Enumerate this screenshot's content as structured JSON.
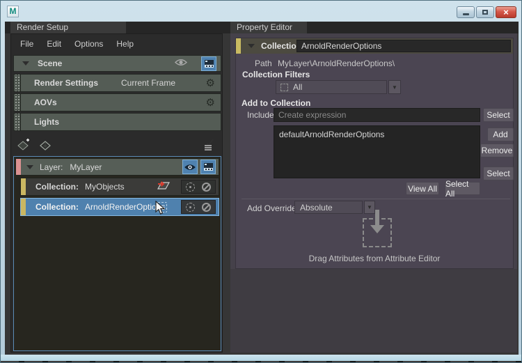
{
  "window": {
    "app_icon": "M",
    "controls": {
      "close_glyph": "×"
    }
  },
  "icons": {
    "gear": "⚙",
    "dropdown_arrow": "▼"
  },
  "tabs": {
    "left": "Render Setup",
    "right": "Property Editor"
  },
  "menu": {
    "items": [
      "File",
      "Edit",
      "Options",
      "Help"
    ]
  },
  "scene_panel": {
    "scene_label": "Scene",
    "rows": [
      {
        "label": "Render Settings",
        "value": "Current Frame"
      },
      {
        "label": "AOVs",
        "value": ""
      },
      {
        "label": "Lights",
        "value": ""
      }
    ]
  },
  "layers_panel": {
    "layer_label": "Layer:",
    "layer_name": "MyLayer",
    "collection_label": "Collection:",
    "collections": [
      {
        "name": "MyObjects"
      },
      {
        "name": "ArnoldRenderOptions"
      }
    ]
  },
  "property_editor": {
    "collection_label": "Collection:",
    "collection_name": "ArnoldRenderOptions",
    "path_label": "Path",
    "path_value": "MyLayer\\ArnoldRenderOptions\\",
    "collection_filters_label": "Collection Filters",
    "filter_all": "All",
    "add_to_collection_label": "Add to Collection",
    "include_label": "Include",
    "include_placeholder": "Create expression",
    "list_items": [
      "defaultArnoldRenderOptions"
    ],
    "buttons": {
      "select_top": "Select",
      "add": "Add",
      "remove": "Remove",
      "select_bottom": "Select",
      "view_all": "View All",
      "select_all": "Select All"
    },
    "add_override_label": "Add Override",
    "override_mode": "Absolute",
    "drop_hint": "Drag Attributes from Attribute Editor"
  }
}
